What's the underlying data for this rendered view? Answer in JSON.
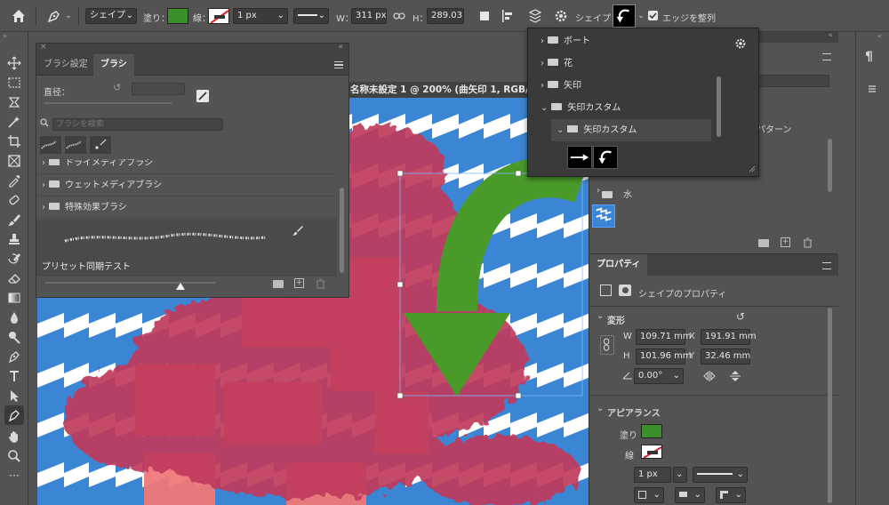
{
  "optbar": {
    "shape_mode": "シェイプ",
    "fill_label": "塗り：",
    "stroke_label": "線：",
    "stroke_width": "1 px",
    "w_label": "W：",
    "w_value": "311 px",
    "h_label": "H：",
    "h_value": "289.03",
    "shape_label": "シェイプ：",
    "align_edges_label": "エッジを整列",
    "align_edges_checked": true,
    "fill_color": "#3c8f2a"
  },
  "document": {
    "tab_title": "名称未設定 1 @ 200% (曲矢印 1, RGB/8"
  },
  "brush_panel": {
    "tab_settings": "ブラシ設定",
    "tab_brush": "ブラシ",
    "size_label": "直径：",
    "search_placeholder": "ブラシを検索",
    "rows": [
      {
        "label": "ドライメディアブラシ"
      },
      {
        "label": "ウェットメディアブラシ"
      },
      {
        "label": "特殊効果ブラシ"
      }
    ],
    "preset_label": "プリセット同期テスト"
  },
  "shape_picker": {
    "rows": [
      {
        "label": "ボート"
      },
      {
        "label": "花"
      },
      {
        "label": "矢印"
      },
      {
        "label": "矢印カスタム"
      },
      {
        "label": "矢印カスタム"
      }
    ]
  },
  "shapes_panel": {
    "pattern_label": "パターン",
    "water_label": "水"
  },
  "properties": {
    "tab": "プロパティ",
    "shape_props": "シェイプのプロパティ",
    "transform_label": "変形",
    "w_label": "W",
    "w_value": "109.71 mm",
    "x_label": "X",
    "x_value": "191.91 mm",
    "h_label": "H",
    "h_value": "101.96 mm",
    "y_label": "Y",
    "y_value": "32.46 mm",
    "angle_value": "0.00°",
    "appearance_label": "アピアランス",
    "fill_label": "塗り",
    "stroke_label": "線",
    "stroke_width": "1 px"
  },
  "colors": {
    "canvas_blue": "#3a85d4",
    "arrow_green": "#4a9a2a",
    "splatter_red": "#c33a5a",
    "pink": "#f07878"
  }
}
